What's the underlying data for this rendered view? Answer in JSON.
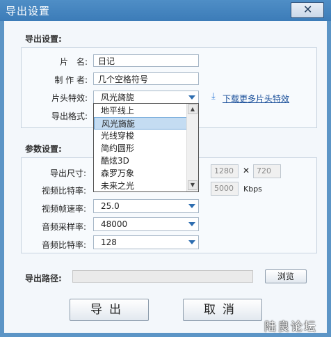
{
  "window": {
    "title": "导出设置",
    "close_icon": "close-icon"
  },
  "export_settings": {
    "section_label": "导出设置:",
    "title_label": "片　名:",
    "title_value": "日记",
    "author_label": "制 作 者:",
    "author_value": "几个空格符号",
    "intro_label": "片头特效:",
    "intro_value": "风光旖旎",
    "download_link": "下载更多片头特效",
    "format_label": "导出格式:",
    "intro_options": [
      "地平线上",
      "风光旖旎",
      "光线穿梭",
      "简约圆形",
      "酷炫3D",
      "森罗万象",
      "未来之光"
    ],
    "intro_selected": "风光旖旎"
  },
  "params": {
    "section_label": "参数设置:",
    "size_label": "导出尺寸:",
    "width": "1280",
    "height": "720",
    "x_sep": "✕",
    "vbitrate_label": "视频比特率:",
    "vbitrate_value": "5000",
    "vbitrate_unit": "Kbps",
    "framerate_label": "视频帧速率:",
    "framerate_value": "25.0",
    "samplerate_label": "音频采样率:",
    "samplerate_value": "48000",
    "abitrate_label": "音频比特率:",
    "abitrate_value": "128"
  },
  "path": {
    "label": "导出路径:",
    "value": "",
    "browse": "浏览"
  },
  "buttons": {
    "export": "导出",
    "cancel": "取消"
  },
  "watermark": "陆良论坛"
}
